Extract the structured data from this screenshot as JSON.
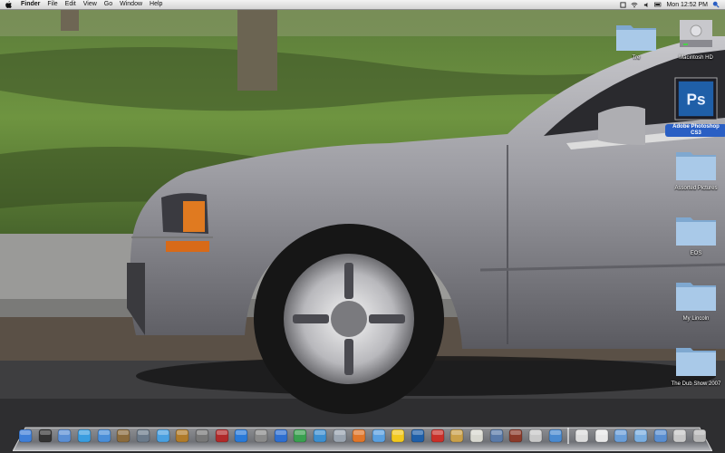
{
  "menubar": {
    "apple_menu": "apple-logo-icon",
    "app_name": "Finder",
    "menus": [
      "File",
      "Edit",
      "View",
      "Go",
      "Window",
      "Help"
    ],
    "status_icons": [
      "menu-extra-icon",
      "wifi-icon",
      "volume-icon",
      "battery-icon"
    ],
    "clock": "Mon 12:52 PM",
    "search_icon": "spotlight-icon"
  },
  "desktop": {
    "icons": [
      {
        "label": "Tre",
        "icon": "folder-icon"
      },
      {
        "label": "Macintosh HD",
        "icon": "hard-drive-icon"
      },
      {
        "label": "Adobe Photoshop CS3",
        "icon": "photoshop-icon",
        "selected": true,
        "badge_text": "Ps"
      },
      {
        "label": "Assorted Pictures",
        "icon": "folder-icon"
      },
      {
        "label": "EOS",
        "icon": "folder-icon"
      },
      {
        "label": "My Lincoln",
        "icon": "folder-icon"
      },
      {
        "label": "The Dub Show 2007",
        "icon": "folder-icon"
      }
    ]
  },
  "dock": {
    "apps": [
      {
        "name": "finder-icon",
        "color": "#3f7fd8"
      },
      {
        "name": "dashboard-icon",
        "color": "#333333"
      },
      {
        "name": "preview-icon",
        "color": "#5b8fd4"
      },
      {
        "name": "safari-icon",
        "color": "#3a9de0"
      },
      {
        "name": "ichat-icon",
        "color": "#4a8ed8"
      },
      {
        "name": "address-book-icon",
        "color": "#8a6b3d"
      },
      {
        "name": "iphoto-icon",
        "color": "#6b7a8a"
      },
      {
        "name": "itunes-icon",
        "color": "#4aa0e0"
      },
      {
        "name": "garageband-icon",
        "color": "#b07b2a"
      },
      {
        "name": "image-capture-icon",
        "color": "#777777"
      },
      {
        "name": "book-icon",
        "color": "#b02a2a"
      },
      {
        "name": "bridge-icon",
        "color": "#2a7ad8"
      },
      {
        "name": "network-icon",
        "color": "#8a8a8a"
      },
      {
        "name": "web-browser-icon",
        "color": "#2f6fd0"
      },
      {
        "name": "dreamweaver-icon",
        "color": "#3aa050"
      },
      {
        "name": "people-icon",
        "color": "#3d8fd0"
      },
      {
        "name": "mail-icon",
        "color": "#9aa4b0"
      },
      {
        "name": "firefox-icon",
        "color": "#e0762a"
      },
      {
        "name": "messenger-icon",
        "color": "#5aa0e0"
      },
      {
        "name": "yahoo-messenger-icon",
        "color": "#f2c81e"
      },
      {
        "name": "photoshop-icon",
        "color": "#1f5fa8"
      },
      {
        "name": "flash-icon",
        "color": "#c8302a"
      },
      {
        "name": "script-editor-icon",
        "color": "#c9a04a"
      },
      {
        "name": "textedit-icon",
        "color": "#d8d8d0"
      },
      {
        "name": "utility-icon",
        "color": "#5a7aa8"
      },
      {
        "name": "photo-booth-icon",
        "color": "#8a3a2a"
      },
      {
        "name": "printer-icon",
        "color": "#c8c8c8"
      },
      {
        "name": "quicktime-icon",
        "color": "#4a8ad0"
      }
    ],
    "docs": [
      {
        "name": "document-icon",
        "color": "#dcdcdc"
      },
      {
        "name": "pages-icon",
        "color": "#e8e8e8"
      },
      {
        "name": "stack-folder-icon",
        "color": "#6a9ed8"
      },
      {
        "name": "downloads-folder-icon",
        "color": "#7aaee0"
      },
      {
        "name": "applications-folder-icon",
        "color": "#5a8ed0"
      },
      {
        "name": "image-file-icon",
        "color": "#c8c8c8"
      },
      {
        "name": "trash-icon",
        "color": "#b8b8b8"
      }
    ]
  }
}
